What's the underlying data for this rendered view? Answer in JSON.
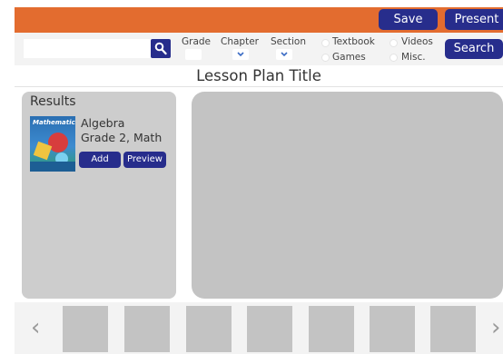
{
  "toolbar": {
    "save_label": "Save",
    "present_label": "Present"
  },
  "filters": {
    "search_placeholder": "",
    "grade_label": "Grade",
    "chapter_label": "Chapter",
    "section_label": "Section",
    "types": [
      "Textbook",
      "Videos",
      "Games",
      "Misc."
    ],
    "search_button_label": "Search"
  },
  "lesson": {
    "title": "Lesson Plan Title"
  },
  "results": {
    "heading": "Results",
    "items": [
      {
        "cover_text": "Mathematics",
        "title": "Algebra",
        "subtitle": "Grade 2, Math",
        "add_label": "Add",
        "preview_label": "Preview"
      }
    ]
  },
  "strip": {
    "prev_arrow": "‹",
    "next_arrow": "›",
    "slot_count": 7
  },
  "colors": {
    "accent_orange": "#e36c2f",
    "button_navy": "#272d8c",
    "panel_gray": "#c3c3c3"
  }
}
